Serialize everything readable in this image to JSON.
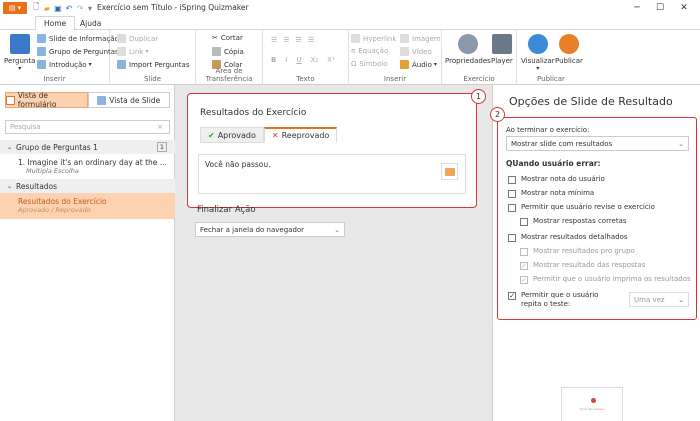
{
  "window": {
    "title": "Exercício sem Título - iSpring Quizmaker"
  },
  "tabs": [
    {
      "label": "Home"
    },
    {
      "label": "Ajuda"
    }
  ],
  "ribbon": {
    "inserir": {
      "label": "Inserir",
      "pergunta": "Pergunta",
      "slide_info": "Slide de Informação",
      "grupo": "Grupo de Perguntas",
      "introducao": "Introdução"
    },
    "slide": {
      "label": "Slide",
      "duplicar": "Duplicar",
      "link": "Link",
      "import": "Import Perguntas"
    },
    "clipboard": {
      "label": "Área de Transferência",
      "cortar": "Cortar",
      "copia": "Cópia",
      "colar": "Colar"
    },
    "texto": {
      "label": "Texto",
      "b": "B",
      "i": "I",
      "u": "U",
      "sub": "X₂",
      "sup": "X²"
    },
    "inserir2": {
      "label": "Inserir",
      "hyperlink": "Hyperlink",
      "equacao": "Equação",
      "simbolo": "Símbolo",
      "imagem": "Imagem",
      "video": "Vídeo",
      "audio": "Áudio"
    },
    "exercicio": {
      "label": "Exercício",
      "propriedades": "Propriedades",
      "player": "Player"
    },
    "publicar": {
      "label": "Publicar",
      "visualizar": "Visualizar",
      "publicar": "Publicar"
    }
  },
  "left": {
    "view_form": "Vista de formulário",
    "view_slide": "Vista de Slide",
    "search_placeholder": "Pesquisa",
    "group1": {
      "title": "Grupo de Perguntas 1",
      "count": "1"
    },
    "question1": {
      "title": "1. Imagine it's an ordinary day at the ...",
      "sub": "Multipla Escolha"
    },
    "group2": {
      "title": "Resultados"
    },
    "result": {
      "title": "Resultados do Exercício",
      "sub": "Aprovado / Reprovado"
    }
  },
  "center": {
    "card_title": "Resultados do Exercício",
    "tab_pass": "Aprovado",
    "tab_fail": "Reeprovado",
    "message": "Você não passou.",
    "badge1": "1",
    "finish_title": "Finalizar Ação",
    "finish_value": "Fechar a janela do navegador"
  },
  "right": {
    "title": "Opções de Slide de Resultado",
    "badge2": "2",
    "on_finish_label": "Ao terminar o exercício:",
    "on_finish_value": "Mostrar slide com resultados",
    "when_fail": "QUando usuário errar:",
    "opts": {
      "show_score": "Mostrar nota do usuário",
      "show_min": "Mostrar nota mínima",
      "allow_review": "Permitir que usuário revise o exercício",
      "show_correct": "Mostrar respostas corretas",
      "show_detailed": "Mostrar resultados detalhados",
      "by_group": "Mostrar resultados pro grupo",
      "answers_result": "Mostrar resultado das respostas",
      "allow_print": "Permitir que o usuário imprima os resultados",
      "allow_retry": "Permitir que o usuário repita o teste:",
      "retry_value": "Uma vez"
    },
    "thumb_text": "Você não passou"
  },
  "colors": {
    "accent": "#e8701a",
    "highlight": "#d8343a",
    "selected": "#fcd2b0"
  }
}
